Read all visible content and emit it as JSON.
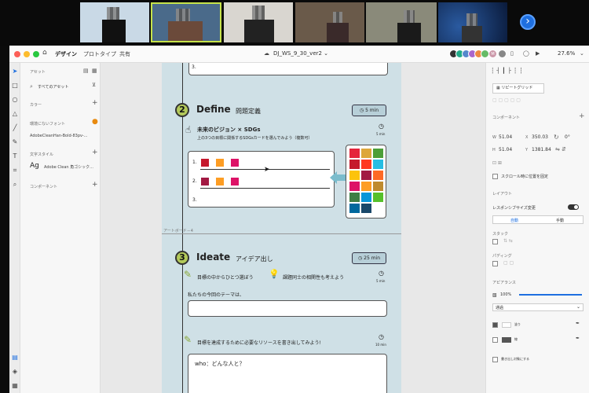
{
  "menu": {
    "design": "デザイン",
    "prototype": "プロトタイプ",
    "share": "共有"
  },
  "doc": {
    "title": "DJ_WS_9_30_ver2 ⌄",
    "cloud_icon": "cloud-icon"
  },
  "zoom": "27.6%",
  "avatars": [
    "",
    "",
    "",
    "",
    "",
    "",
    "M",
    ""
  ],
  "leftpanel": {
    "assets": "アセット",
    "all_assets": "すべてのアセット",
    "colors": "カラー",
    "missing_fonts": "環境にないフォント",
    "font_name": "AdobeCleanHan-Bold-83pv-...",
    "char_styles": "文字スタイル",
    "char_sample": "Ag",
    "char_name": "Adobe Clean 角ゴシック...",
    "components": "コンポーネント"
  },
  "artboard_label": "アートボード－4",
  "define": {
    "num": "2",
    "title": "Define",
    "subtitle": "問題定義",
    "time": "5 min",
    "step_title": "未来のビジョン × SDGs",
    "step_desc": "上の3つの目標に関係するSDGsカードを選んでみよう（複数可）",
    "step_time": "5 min",
    "rows": [
      "1.",
      "2.",
      "3."
    ]
  },
  "ideate": {
    "num": "3",
    "title": "Ideate",
    "subtitle": "アイデア出し",
    "time": "25 min",
    "step1": "目標の中からひとつ選ぼう",
    "step2": "課題同士の相関性も考えよう",
    "step_time": "5 min",
    "theme_label": "私たちの今回のテーマは、",
    "step3": "目標を達成するために必要なリソースを書き出してみよう!",
    "step3_time": "10 min",
    "who": "who：どんな人と？"
  },
  "top_row": "3.",
  "rightpanel": {
    "repeat_grid": "リピートグリッド",
    "component": "コンポーネント",
    "w": "51.04",
    "x": "350.03",
    "rot": "0°",
    "h": "51.04",
    "y": "1381.84",
    "fix_scroll": "スクロール時に位置を固定",
    "layout": "レイアウト",
    "responsive": "レスポンシブサイズ変更",
    "auto": "自動",
    "manual": "手動",
    "stack": "スタック",
    "padding": "パディング",
    "appearance": "アピアランス",
    "opacity": "100%",
    "blend": "通過",
    "fill": "塗り",
    "border": "線",
    "shadow": "書き出し対象にする"
  },
  "colors": {
    "accent": "#1e6fe0",
    "artboard": "#cfe0e6",
    "badge": "#b7cfd8",
    "num": "#b3c95a",
    "arrow": "#7bbccc"
  }
}
